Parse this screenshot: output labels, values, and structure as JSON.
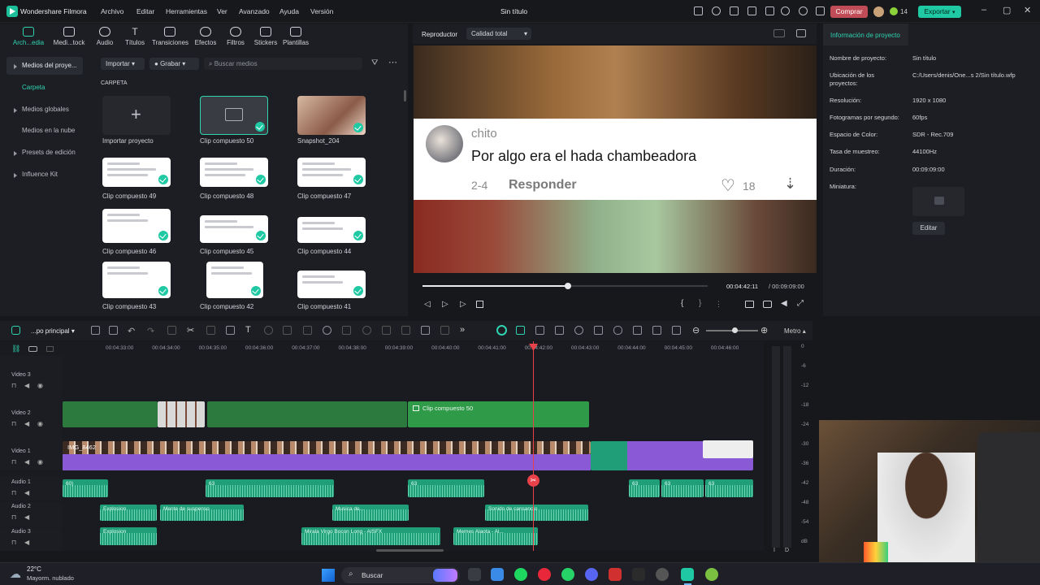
{
  "app": {
    "name": "Wonder​share Filmora",
    "name_text": "Wondershare Filmora",
    "doc_title": "Sin título"
  },
  "menu": [
    "Archivo",
    "Editar",
    "Herramientas",
    "Ver",
    "Avanzado",
    "Ayuda",
    "Versión"
  ],
  "titlebar": {
    "buy_label": "Comprar",
    "export_label": "Exportar",
    "credits": "14"
  },
  "tools": [
    {
      "label": "Arch...edia",
      "icon": "media-icon"
    },
    {
      "label": "Medi...tock",
      "icon": "stock-icon"
    },
    {
      "label": "Audio",
      "icon": "audio-icon"
    },
    {
      "label": "Títulos",
      "icon": "titles-icon"
    },
    {
      "label": "Transiciones",
      "icon": "transitions-icon"
    },
    {
      "label": "Efectos",
      "icon": "effects-icon"
    },
    {
      "label": "Filtros",
      "icon": "filters-icon"
    },
    {
      "label": "Stickers",
      "icon": "stickers-icon"
    },
    {
      "label": "Plantillas",
      "icon": "templates-icon"
    }
  ],
  "sidebar": {
    "items": [
      {
        "label": "Medios del proye..."
      },
      {
        "label": "Carpeta"
      },
      {
        "label": "Medios globales"
      },
      {
        "label": "Medios en la nube"
      },
      {
        "label": "Presets de edición"
      },
      {
        "label": "Influence Kit"
      }
    ]
  },
  "media_toolbar": {
    "import_label": "Importar",
    "record_label": "Grabar",
    "search_placeholder": "Buscar medios"
  },
  "folder_label": "CARPETA",
  "media_items": [
    {
      "label": "Importar proyecto"
    },
    {
      "label": "Clip compuesto 50"
    },
    {
      "label": "Snapshot_204"
    },
    {
      "label": "Clip compuesto 49"
    },
    {
      "label": "Clip compuesto 48"
    },
    {
      "label": "Clip compuesto 47"
    },
    {
      "label": "Clip compuesto 46"
    },
    {
      "label": "Clip compuesto 45"
    },
    {
      "label": "Clip compuesto 44"
    },
    {
      "label": "Clip compuesto 43"
    },
    {
      "label": "Clip compuesto 42"
    },
    {
      "label": "Clip compuesto 41"
    }
  ],
  "preview": {
    "tab_label": "Reproductor",
    "quality": "Calidad total",
    "comment_user": "chito",
    "comment_text": "Por algo era el hada chambeadora",
    "comment_date": "2-4",
    "reply_label": "Responder",
    "likes": "18",
    "current_time": "00:04:42:11",
    "total_time": "/ 00:09:09:00",
    "progress": 0.51
  },
  "project_info": {
    "tab_label": "Información de proyecto",
    "rows": [
      {
        "k": "Nombre de proyecto:",
        "v": "Sin título"
      },
      {
        "k": "Ubicación de los proyectos:",
        "v": "C:/Users/denis/One...s 2/Sin título.wfp"
      },
      {
        "k": "Resolución:",
        "v": "1920 x 1080"
      },
      {
        "k": "Fotogramas por segundo:",
        "v": "60fps"
      },
      {
        "k": "Espacio de Color:",
        "v": "SDR - Rec.709"
      },
      {
        "k": "Tasa de muestreo:",
        "v": "44100Hz"
      },
      {
        "k": "Duración:",
        "v": "00:09:09:00"
      },
      {
        "k": "Miniatura:",
        "v": ""
      }
    ],
    "edit_label": "Editar"
  },
  "timeline": {
    "sequence_label": "...po principal",
    "meter_label": "Metro",
    "ticks": [
      "00:04:33:00",
      "00:04:34:00",
      "00:04:35:00",
      "00:04:36:00",
      "00:04:37:00",
      "00:04:38:00",
      "00:04:39:00",
      "00:04:40:00",
      "00:04:41:00",
      "00:04:42:00",
      "00:04:43:00",
      "00:04:44:00",
      "00:04:45:00",
      "00:04:46:00"
    ],
    "tracks": [
      {
        "name": "Video 3"
      },
      {
        "name": "Video 2"
      },
      {
        "name": "Video 1"
      },
      {
        "name": "Audio 1"
      },
      {
        "name": "Audio 2"
      },
      {
        "name": "Audio 3"
      }
    ],
    "clip_compuesto": "Clip compuesto 50",
    "video1_label": "IMG_8462",
    "audio_labels": {
      "a1": [
        "60)",
        "63",
        "63",
        "63",
        "63",
        "63"
      ],
      "a2": [
        "Explosion",
        "Mente de suspenso",
        "Musica de...",
        "Sonido de cansancio"
      ],
      "a3": [
        "Explosion",
        "Mirala Virgo Bocon Long - AISFX",
        "Memes Alaota - Al..."
      ]
    },
    "db_scale": [
      "0",
      "-6",
      "-12",
      "-18",
      "-24",
      "-30",
      "-36",
      "-42",
      "-48",
      "-54",
      "dB"
    ],
    "lr": [
      "I",
      "D"
    ]
  },
  "taskbar": {
    "weather_temp": "22°C",
    "weather_desc": "Mayorm. nublado",
    "search_label": "Buscar"
  },
  "colors": {
    "accent": "#1fc9a4",
    "playhead": "#e8414a",
    "video2": "#2c9a4a",
    "video1_purple": "#8a5ad6",
    "audio": "#1f9e78"
  }
}
